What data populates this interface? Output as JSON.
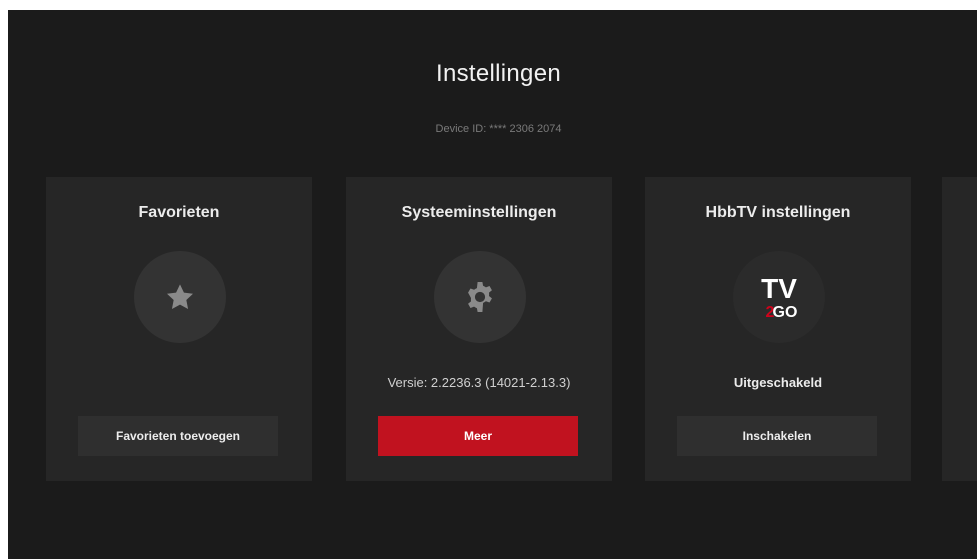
{
  "header": {
    "title": "Instellingen",
    "device_id": "Device ID: **** 2306 2074"
  },
  "cards": [
    {
      "title": "Favorieten",
      "icon": "star-icon",
      "status": "",
      "button_label": "Favorieten toevoegen"
    },
    {
      "title": "Systeeminstellingen",
      "icon": "gear-icon",
      "status": "Versie: 2.2236.3 (14021-2.13.3)",
      "button_label": "Meer"
    },
    {
      "title": "HbbTV instellingen",
      "icon": "tv2go-logo",
      "logo_text": [
        "TV",
        "2",
        "GO"
      ],
      "status": "Uitgeschakeld",
      "button_label": "Inschakelen"
    }
  ],
  "colors": {
    "background": "#1b1b1b",
    "card": "#262626",
    "accent": "#c1121f",
    "logo_accent": "#d0021b"
  }
}
